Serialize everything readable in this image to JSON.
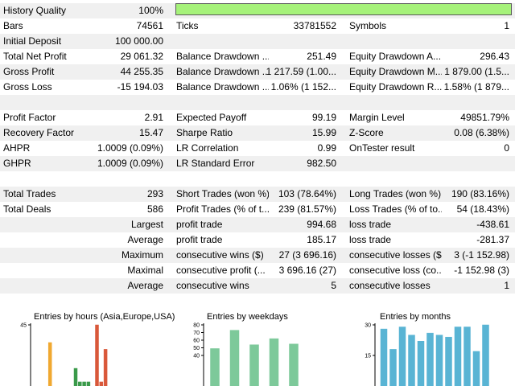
{
  "report": {
    "rows": [
      {
        "shade": true,
        "cells": [
          {
            "t": "History Quality",
            "cls": "lab c0"
          },
          {
            "t": "100%",
            "cls": "val v0"
          }
        ]
      },
      {
        "shade": false,
        "cells": [
          {
            "t": "Bars",
            "cls": "lab c0"
          },
          {
            "t": "74561",
            "cls": "val v0"
          },
          {
            "t": "Ticks",
            "cls": "lab c1"
          },
          {
            "t": "33781552",
            "cls": "val v1"
          },
          {
            "t": "Symbols",
            "cls": "lab c2"
          },
          {
            "t": "1",
            "cls": "val v2"
          }
        ]
      },
      {
        "shade": true,
        "cells": [
          {
            "t": "Initial Deposit",
            "cls": "lab c0"
          },
          {
            "t": "100 000.00",
            "cls": "val v0"
          }
        ]
      },
      {
        "shade": false,
        "cells": [
          {
            "t": "Total Net Profit",
            "cls": "lab c0"
          },
          {
            "t": "29 061.32",
            "cls": "val v0"
          },
          {
            "t": "Balance Drawdown ...",
            "cls": "lab c1"
          },
          {
            "t": "251.49",
            "cls": "val v1"
          },
          {
            "t": "Equity Drawdown A...",
            "cls": "lab c2"
          },
          {
            "t": "296.43",
            "cls": "val v2"
          }
        ]
      },
      {
        "shade": true,
        "cells": [
          {
            "t": "Gross Profit",
            "cls": "lab c0"
          },
          {
            "t": "44 255.35",
            "cls": "val v0"
          },
          {
            "t": "Balance Drawdown ...",
            "cls": "lab c1"
          },
          {
            "t": "1 217.59 (1.00...",
            "cls": "val v1"
          },
          {
            "t": "Equity Drawdown M...",
            "cls": "lab c2"
          },
          {
            "t": "1 879.00 (1.5...",
            "cls": "val v2"
          }
        ]
      },
      {
        "shade": false,
        "cells": [
          {
            "t": "Gross Loss",
            "cls": "lab c0"
          },
          {
            "t": "-15 194.03",
            "cls": "val v0"
          },
          {
            "t": "Balance Drawdown ...",
            "cls": "lab c1"
          },
          {
            "t": "1.06% (1 152...",
            "cls": "val v1"
          },
          {
            "t": "Equity Drawdown R...",
            "cls": "lab c2"
          },
          {
            "t": "1.58% (1 879...",
            "cls": "val v2"
          }
        ]
      },
      {
        "shade": true,
        "cells": []
      },
      {
        "shade": false,
        "cells": [
          {
            "t": "Profit Factor",
            "cls": "lab c0"
          },
          {
            "t": "2.91",
            "cls": "val v0"
          },
          {
            "t": "Expected Payoff",
            "cls": "lab c1"
          },
          {
            "t": "99.19",
            "cls": "val v1"
          },
          {
            "t": "Margin Level",
            "cls": "lab c2"
          },
          {
            "t": "49851.79%",
            "cls": "val v2"
          }
        ]
      },
      {
        "shade": true,
        "cells": [
          {
            "t": "Recovery Factor",
            "cls": "lab c0"
          },
          {
            "t": "15.47",
            "cls": "val v0"
          },
          {
            "t": "Sharpe Ratio",
            "cls": "lab c1"
          },
          {
            "t": "15.99",
            "cls": "val v1"
          },
          {
            "t": "Z-Score",
            "cls": "lab c2"
          },
          {
            "t": "0.08 (6.38%)",
            "cls": "val v2"
          }
        ]
      },
      {
        "shade": false,
        "cells": [
          {
            "t": "AHPR",
            "cls": "lab c0"
          },
          {
            "t": "1.0009 (0.09%)",
            "cls": "val v0"
          },
          {
            "t": "LR Correlation",
            "cls": "lab c1"
          },
          {
            "t": "0.99",
            "cls": "val v1"
          },
          {
            "t": "OnTester result",
            "cls": "lab c2"
          },
          {
            "t": "0",
            "cls": "val v2"
          }
        ]
      },
      {
        "shade": true,
        "cells": [
          {
            "t": "GHPR",
            "cls": "lab c0"
          },
          {
            "t": "1.0009 (0.09%)",
            "cls": "val v0"
          },
          {
            "t": "LR Standard Error",
            "cls": "lab c1"
          },
          {
            "t": "982.50",
            "cls": "val v1"
          }
        ]
      },
      {
        "shade": false,
        "cells": []
      },
      {
        "shade": true,
        "cells": [
          {
            "t": "Total Trades",
            "cls": "lab c0"
          },
          {
            "t": "293",
            "cls": "val v0"
          },
          {
            "t": "Short Trades (won %)",
            "cls": "lab c1"
          },
          {
            "t": "103 (78.64%)",
            "cls": "val v1"
          },
          {
            "t": "Long Trades (won %)",
            "cls": "lab c2"
          },
          {
            "t": "190 (83.16%)",
            "cls": "val v2"
          }
        ]
      },
      {
        "shade": false,
        "cells": [
          {
            "t": "Total Deals",
            "cls": "lab c0"
          },
          {
            "t": "586",
            "cls": "val v0"
          },
          {
            "t": "Profit Trades (% of t...",
            "cls": "lab c1"
          },
          {
            "t": "239 (81.57%)",
            "cls": "val v1"
          },
          {
            "t": "Loss Trades (% of to...",
            "cls": "lab c2"
          },
          {
            "t": "54 (18.43%)",
            "cls": "val v2"
          }
        ]
      },
      {
        "shade": true,
        "cells": [
          {
            "t": "Largest",
            "cls": "val r0"
          },
          {
            "t": "profit trade",
            "cls": "lab c1"
          },
          {
            "t": "994.68",
            "cls": "val v1"
          },
          {
            "t": "loss trade",
            "cls": "lab c2"
          },
          {
            "t": "-438.61",
            "cls": "val v2"
          }
        ]
      },
      {
        "shade": false,
        "cells": [
          {
            "t": "Average",
            "cls": "val r0"
          },
          {
            "t": "profit trade",
            "cls": "lab c1"
          },
          {
            "t": "185.17",
            "cls": "val v1"
          },
          {
            "t": "loss trade",
            "cls": "lab c2"
          },
          {
            "t": "-281.37",
            "cls": "val v2"
          }
        ]
      },
      {
        "shade": true,
        "cells": [
          {
            "t": "Maximum",
            "cls": "val r0"
          },
          {
            "t": "consecutive wins ($)",
            "cls": "lab c1"
          },
          {
            "t": "27 (3 696.16)",
            "cls": "val v1"
          },
          {
            "t": "consecutive losses ($)",
            "cls": "lab c2"
          },
          {
            "t": "3 (-1 152.98)",
            "cls": "val v2"
          }
        ]
      },
      {
        "shade": false,
        "cells": [
          {
            "t": "Maximal",
            "cls": "val r0"
          },
          {
            "t": "consecutive profit (...",
            "cls": "lab c1"
          },
          {
            "t": "3 696.16 (27)",
            "cls": "val v1"
          },
          {
            "t": "consecutive loss (co...",
            "cls": "lab c2"
          },
          {
            "t": "-1 152.98 (3)",
            "cls": "val v2"
          }
        ]
      },
      {
        "shade": true,
        "cells": [
          {
            "t": "Average",
            "cls": "val r0"
          },
          {
            "t": "consecutive wins",
            "cls": "lab c1"
          },
          {
            "t": "5",
            "cls": "val v1"
          },
          {
            "t": "consecutive losses",
            "cls": "lab c2"
          },
          {
            "t": "1",
            "cls": "val v2"
          }
        ]
      }
    ],
    "history_quality_fill": 1.0,
    "bar_color": "#a6f27a"
  },
  "chart_data": [
    {
      "type": "bar",
      "title": "Entries by hours (Asia,Europe,USA)",
      "yticks": [
        45
      ],
      "ylim": [
        0,
        45
      ],
      "colors": [
        "#f0a830",
        "#3a9a4a",
        "#d9583a"
      ],
      "bars": [
        {
          "x": 4,
          "value": 32,
          "color": 0
        },
        {
          "x": 10,
          "value": 13,
          "color": 1
        },
        {
          "x": 11,
          "value": 3,
          "color": 1
        },
        {
          "x": 12,
          "value": 3,
          "color": 1
        },
        {
          "x": 13,
          "value": 3,
          "color": 1
        },
        {
          "x": 15,
          "value": 45,
          "color": 2
        },
        {
          "x": 16,
          "value": 3,
          "color": 2
        },
        {
          "x": 17,
          "value": 27,
          "color": 2
        }
      ]
    },
    {
      "type": "bar",
      "title": "Entries by weekdays",
      "yticks": [
        80,
        70,
        60,
        50,
        40
      ],
      "ylim": [
        0,
        80
      ],
      "colors": [
        "#7dc99a"
      ],
      "bars": [
        {
          "x": 1,
          "value": 49,
          "color": 0
        },
        {
          "x": 2,
          "value": 73,
          "color": 0
        },
        {
          "x": 3,
          "value": 54,
          "color": 0
        },
        {
          "x": 4,
          "value": 62,
          "color": 0
        },
        {
          "x": 5,
          "value": 55,
          "color": 0
        }
      ]
    },
    {
      "type": "bar",
      "title": "Entries by months",
      "yticks": [
        30,
        15
      ],
      "ylim": [
        0,
        30
      ],
      "colors": [
        "#59b4d4"
      ],
      "bars": [
        {
          "x": 1,
          "value": 28,
          "color": 0
        },
        {
          "x": 2,
          "value": 18,
          "color": 0
        },
        {
          "x": 3,
          "value": 29,
          "color": 0
        },
        {
          "x": 4,
          "value": 25,
          "color": 0
        },
        {
          "x": 5,
          "value": 22,
          "color": 0
        },
        {
          "x": 6,
          "value": 26,
          "color": 0
        },
        {
          "x": 7,
          "value": 25,
          "color": 0
        },
        {
          "x": 8,
          "value": 24,
          "color": 0
        },
        {
          "x": 9,
          "value": 29,
          "color": 0
        },
        {
          "x": 10,
          "value": 29,
          "color": 0
        },
        {
          "x": 11,
          "value": 17,
          "color": 0
        },
        {
          "x": 12,
          "value": 30,
          "color": 0
        }
      ]
    }
  ]
}
